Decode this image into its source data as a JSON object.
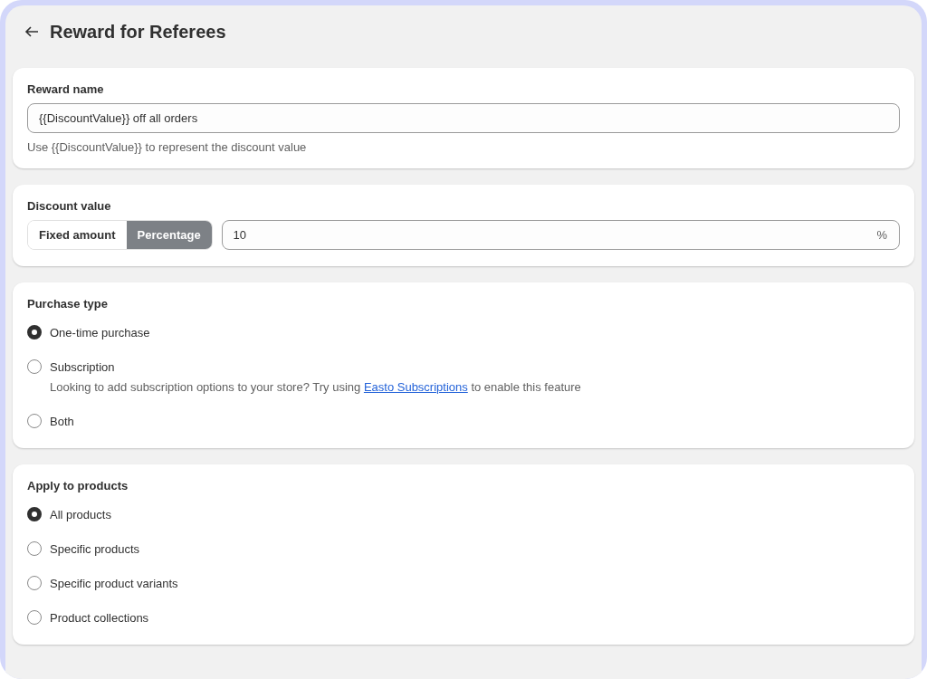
{
  "page": {
    "title": "Reward for Referees"
  },
  "reward_name": {
    "label": "Reward name",
    "value": "{{DiscountValue}} off all orders",
    "help": "Use {{DiscountValue}} to represent the discount value"
  },
  "discount_value": {
    "label": "Discount value",
    "options": [
      {
        "label": "Fixed amount",
        "selected": false
      },
      {
        "label": "Percentage",
        "selected": true
      }
    ],
    "value": "10",
    "suffix": "%"
  },
  "purchase_type": {
    "label": "Purchase type",
    "options": [
      {
        "label": "One-time purchase",
        "selected": true
      },
      {
        "label": "Subscription",
        "selected": false,
        "note": {
          "before": "Looking to add subscription options to your store? Try using",
          "link": "Easto Subscriptions",
          "after": "to enable this feature"
        }
      },
      {
        "label": "Both",
        "selected": false
      }
    ]
  },
  "apply_to_products": {
    "label": "Apply to products",
    "options": [
      {
        "label": "All products",
        "selected": true
      },
      {
        "label": "Specific products",
        "selected": false
      },
      {
        "label": "Specific product variants",
        "selected": false
      },
      {
        "label": "Product collections",
        "selected": false
      }
    ]
  }
}
